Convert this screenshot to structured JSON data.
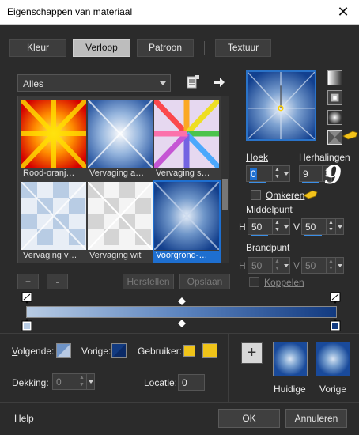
{
  "window": {
    "title": "Eigenschappen van materiaal"
  },
  "tabs": [
    {
      "label": "Kleur"
    },
    {
      "label": "Verloop"
    },
    {
      "label": "Patroon"
    },
    {
      "label": "Textuur"
    }
  ],
  "filter": {
    "value": "Alles"
  },
  "gallery": {
    "items": [
      {
        "caption": "Rood-oranj…"
      },
      {
        "caption": "Vervaging a…"
      },
      {
        "caption": "Vervaging s…"
      },
      {
        "caption": "Vervaging v…"
      },
      {
        "caption": "Vervaging wit"
      },
      {
        "caption": "Voorgrond-…"
      }
    ]
  },
  "gallery_buttons": {
    "add": "+",
    "remove": "-",
    "reset": "Herstellen",
    "save": "Opslaan"
  },
  "angle": {
    "label": "Hoek",
    "value": "0"
  },
  "repeats": {
    "label": "Herhalingen",
    "value": "9"
  },
  "annotation_number": "9",
  "invert": {
    "label": "Omkeren",
    "checked": false
  },
  "center": {
    "label": "Middelpunt",
    "h_label": "H",
    "h_value": "50",
    "v_label": "V",
    "v_value": "50"
  },
  "focus": {
    "label": "Brandpunt",
    "h_label": "H",
    "h_value": "50",
    "v_label": "V",
    "v_value": "50"
  },
  "link": {
    "label": "Koppelen"
  },
  "stops": {
    "next_label": "Volgende:",
    "prev_label": "Vorige:",
    "user_label": "Gebruiker:",
    "opacity_label": "Dekking:",
    "opacity_value": "0",
    "location_label": "Locatie:",
    "location_value": "0"
  },
  "swatches": {
    "current_label": "Huidige",
    "previous_label": "Vorige"
  },
  "footer": {
    "help": "Help",
    "ok": "OK",
    "cancel": "Annuleren"
  },
  "colors": {
    "accent": "#1e6fd0",
    "gradient_start": "#b8cce4",
    "gradient_end": "#123a80",
    "user_swatch": "#f0c419"
  }
}
